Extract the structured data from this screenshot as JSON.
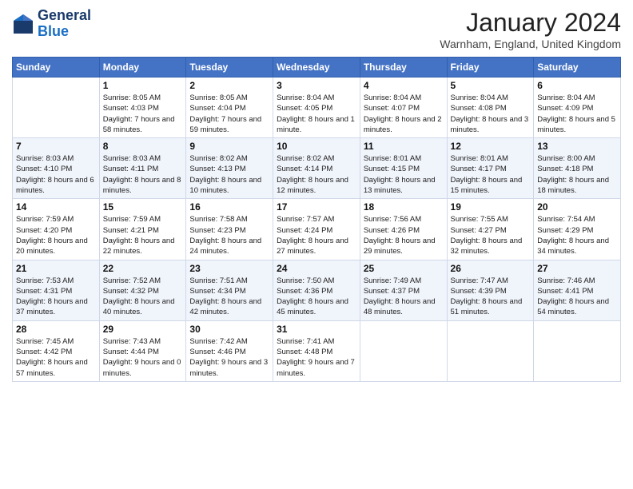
{
  "header": {
    "logo": {
      "line1": "General",
      "line2": "Blue"
    },
    "title": "January 2024",
    "location": "Warnham, England, United Kingdom"
  },
  "weekdays": [
    "Sunday",
    "Monday",
    "Tuesday",
    "Wednesday",
    "Thursday",
    "Friday",
    "Saturday"
  ],
  "weeks": [
    [
      {
        "day": "",
        "sunrise": "",
        "sunset": "",
        "daylight": ""
      },
      {
        "day": "1",
        "sunrise": "Sunrise: 8:05 AM",
        "sunset": "Sunset: 4:03 PM",
        "daylight": "Daylight: 7 hours and 58 minutes."
      },
      {
        "day": "2",
        "sunrise": "Sunrise: 8:05 AM",
        "sunset": "Sunset: 4:04 PM",
        "daylight": "Daylight: 7 hours and 59 minutes."
      },
      {
        "day": "3",
        "sunrise": "Sunrise: 8:04 AM",
        "sunset": "Sunset: 4:05 PM",
        "daylight": "Daylight: 8 hours and 1 minute."
      },
      {
        "day": "4",
        "sunrise": "Sunrise: 8:04 AM",
        "sunset": "Sunset: 4:07 PM",
        "daylight": "Daylight: 8 hours and 2 minutes."
      },
      {
        "day": "5",
        "sunrise": "Sunrise: 8:04 AM",
        "sunset": "Sunset: 4:08 PM",
        "daylight": "Daylight: 8 hours and 3 minutes."
      },
      {
        "day": "6",
        "sunrise": "Sunrise: 8:04 AM",
        "sunset": "Sunset: 4:09 PM",
        "daylight": "Daylight: 8 hours and 5 minutes."
      }
    ],
    [
      {
        "day": "7",
        "sunrise": "Sunrise: 8:03 AM",
        "sunset": "Sunset: 4:10 PM",
        "daylight": "Daylight: 8 hours and 6 minutes."
      },
      {
        "day": "8",
        "sunrise": "Sunrise: 8:03 AM",
        "sunset": "Sunset: 4:11 PM",
        "daylight": "Daylight: 8 hours and 8 minutes."
      },
      {
        "day": "9",
        "sunrise": "Sunrise: 8:02 AM",
        "sunset": "Sunset: 4:13 PM",
        "daylight": "Daylight: 8 hours and 10 minutes."
      },
      {
        "day": "10",
        "sunrise": "Sunrise: 8:02 AM",
        "sunset": "Sunset: 4:14 PM",
        "daylight": "Daylight: 8 hours and 12 minutes."
      },
      {
        "day": "11",
        "sunrise": "Sunrise: 8:01 AM",
        "sunset": "Sunset: 4:15 PM",
        "daylight": "Daylight: 8 hours and 13 minutes."
      },
      {
        "day": "12",
        "sunrise": "Sunrise: 8:01 AM",
        "sunset": "Sunset: 4:17 PM",
        "daylight": "Daylight: 8 hours and 15 minutes."
      },
      {
        "day": "13",
        "sunrise": "Sunrise: 8:00 AM",
        "sunset": "Sunset: 4:18 PM",
        "daylight": "Daylight: 8 hours and 18 minutes."
      }
    ],
    [
      {
        "day": "14",
        "sunrise": "Sunrise: 7:59 AM",
        "sunset": "Sunset: 4:20 PM",
        "daylight": "Daylight: 8 hours and 20 minutes."
      },
      {
        "day": "15",
        "sunrise": "Sunrise: 7:59 AM",
        "sunset": "Sunset: 4:21 PM",
        "daylight": "Daylight: 8 hours and 22 minutes."
      },
      {
        "day": "16",
        "sunrise": "Sunrise: 7:58 AM",
        "sunset": "Sunset: 4:23 PM",
        "daylight": "Daylight: 8 hours and 24 minutes."
      },
      {
        "day": "17",
        "sunrise": "Sunrise: 7:57 AM",
        "sunset": "Sunset: 4:24 PM",
        "daylight": "Daylight: 8 hours and 27 minutes."
      },
      {
        "day": "18",
        "sunrise": "Sunrise: 7:56 AM",
        "sunset": "Sunset: 4:26 PM",
        "daylight": "Daylight: 8 hours and 29 minutes."
      },
      {
        "day": "19",
        "sunrise": "Sunrise: 7:55 AM",
        "sunset": "Sunset: 4:27 PM",
        "daylight": "Daylight: 8 hours and 32 minutes."
      },
      {
        "day": "20",
        "sunrise": "Sunrise: 7:54 AM",
        "sunset": "Sunset: 4:29 PM",
        "daylight": "Daylight: 8 hours and 34 minutes."
      }
    ],
    [
      {
        "day": "21",
        "sunrise": "Sunrise: 7:53 AM",
        "sunset": "Sunset: 4:31 PM",
        "daylight": "Daylight: 8 hours and 37 minutes."
      },
      {
        "day": "22",
        "sunrise": "Sunrise: 7:52 AM",
        "sunset": "Sunset: 4:32 PM",
        "daylight": "Daylight: 8 hours and 40 minutes."
      },
      {
        "day": "23",
        "sunrise": "Sunrise: 7:51 AM",
        "sunset": "Sunset: 4:34 PM",
        "daylight": "Daylight: 8 hours and 42 minutes."
      },
      {
        "day": "24",
        "sunrise": "Sunrise: 7:50 AM",
        "sunset": "Sunset: 4:36 PM",
        "daylight": "Daylight: 8 hours and 45 minutes."
      },
      {
        "day": "25",
        "sunrise": "Sunrise: 7:49 AM",
        "sunset": "Sunset: 4:37 PM",
        "daylight": "Daylight: 8 hours and 48 minutes."
      },
      {
        "day": "26",
        "sunrise": "Sunrise: 7:47 AM",
        "sunset": "Sunset: 4:39 PM",
        "daylight": "Daylight: 8 hours and 51 minutes."
      },
      {
        "day": "27",
        "sunrise": "Sunrise: 7:46 AM",
        "sunset": "Sunset: 4:41 PM",
        "daylight": "Daylight: 8 hours and 54 minutes."
      }
    ],
    [
      {
        "day": "28",
        "sunrise": "Sunrise: 7:45 AM",
        "sunset": "Sunset: 4:42 PM",
        "daylight": "Daylight: 8 hours and 57 minutes."
      },
      {
        "day": "29",
        "sunrise": "Sunrise: 7:43 AM",
        "sunset": "Sunset: 4:44 PM",
        "daylight": "Daylight: 9 hours and 0 minutes."
      },
      {
        "day": "30",
        "sunrise": "Sunrise: 7:42 AM",
        "sunset": "Sunset: 4:46 PM",
        "daylight": "Daylight: 9 hours and 3 minutes."
      },
      {
        "day": "31",
        "sunrise": "Sunrise: 7:41 AM",
        "sunset": "Sunset: 4:48 PM",
        "daylight": "Daylight: 9 hours and 7 minutes."
      },
      {
        "day": "",
        "sunrise": "",
        "sunset": "",
        "daylight": ""
      },
      {
        "day": "",
        "sunrise": "",
        "sunset": "",
        "daylight": ""
      },
      {
        "day": "",
        "sunrise": "",
        "sunset": "",
        "daylight": ""
      }
    ]
  ]
}
